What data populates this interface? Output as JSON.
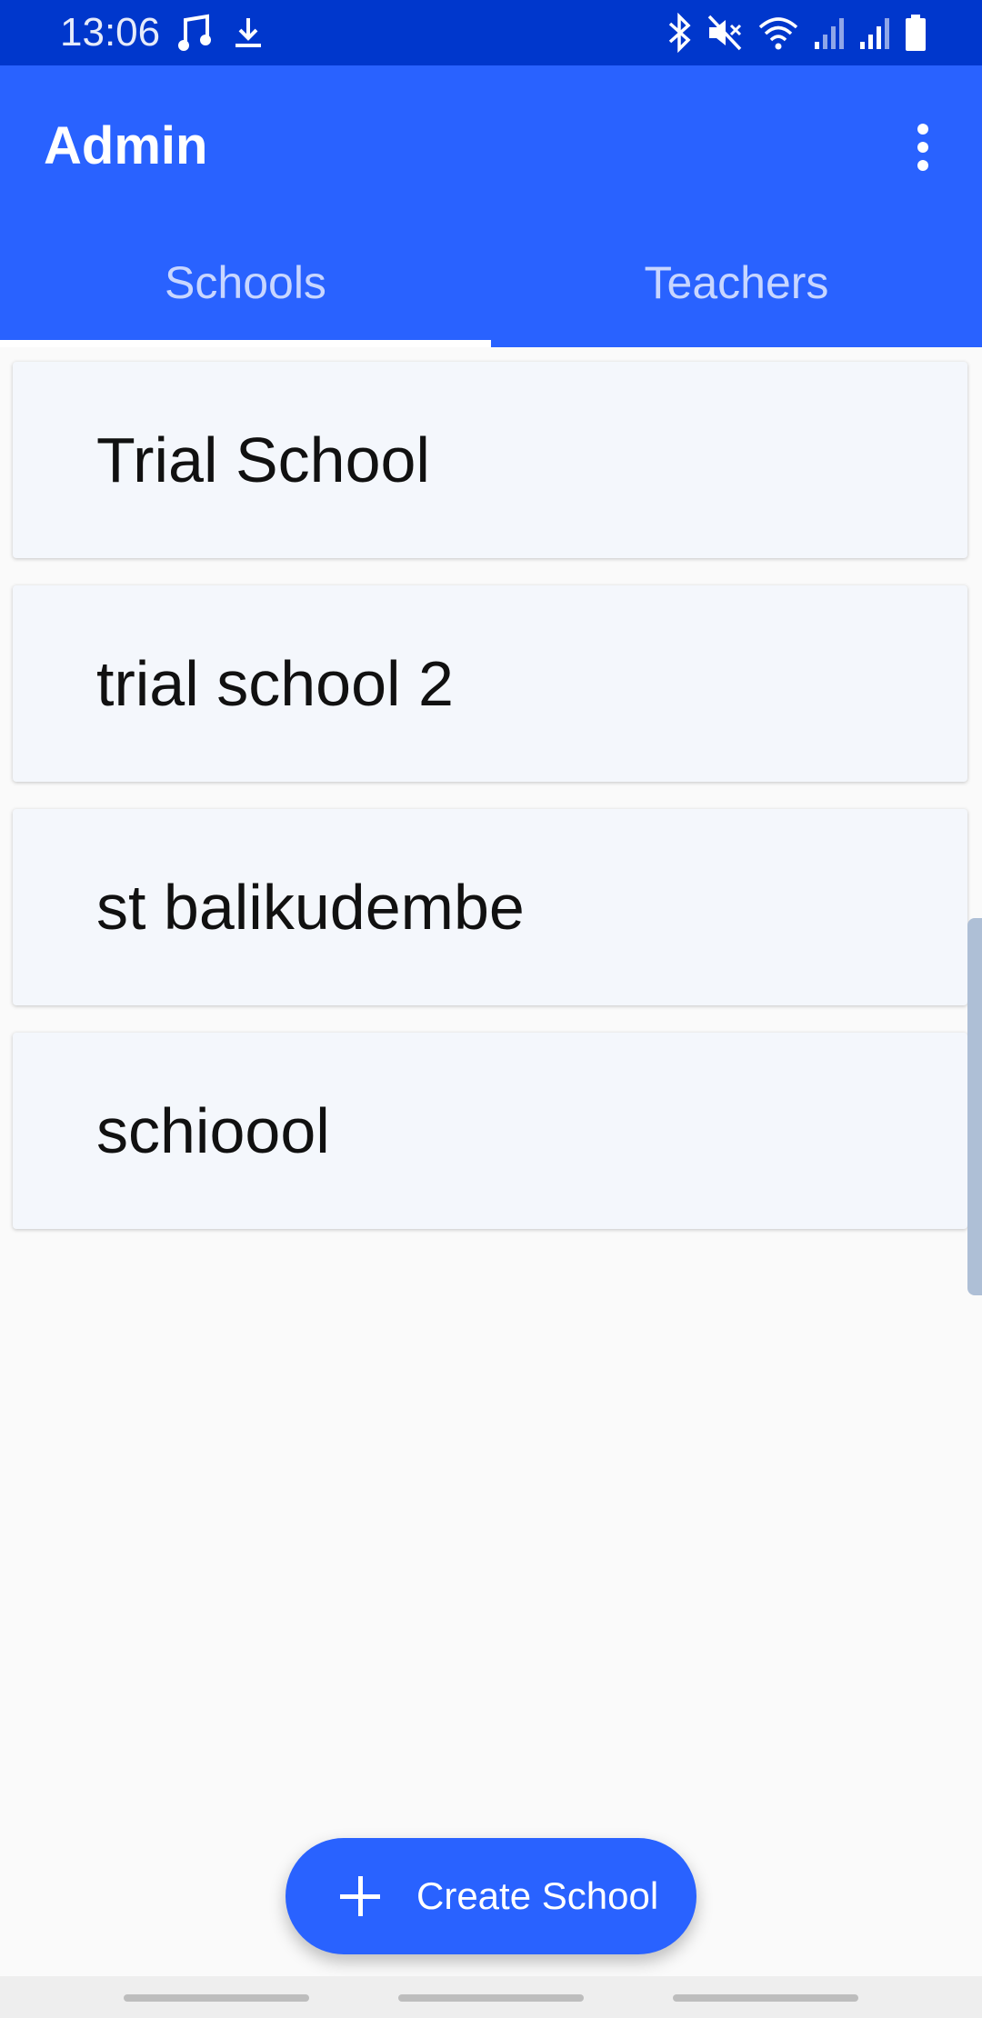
{
  "status_bar": {
    "time": "13:06",
    "left_icons": [
      "music-note-icon",
      "download-icon"
    ],
    "right_icons": [
      "bluetooth-icon",
      "mute-icon",
      "wifi-icon",
      "signal-icon",
      "signal-icon",
      "battery-icon"
    ]
  },
  "app_bar": {
    "title": "Admin",
    "color": "#2962ff",
    "overflow_icon": "more-vert-icon"
  },
  "tabs": [
    {
      "label": "Schools",
      "active": true
    },
    {
      "label": "Teachers",
      "active": false
    }
  ],
  "schools": [
    {
      "name": "Trial School"
    },
    {
      "name": "trial school 2"
    },
    {
      "name": "st balikudembe"
    },
    {
      "name": "schioool"
    }
  ],
  "fab": {
    "label": "Create School",
    "icon": "plus-icon"
  }
}
